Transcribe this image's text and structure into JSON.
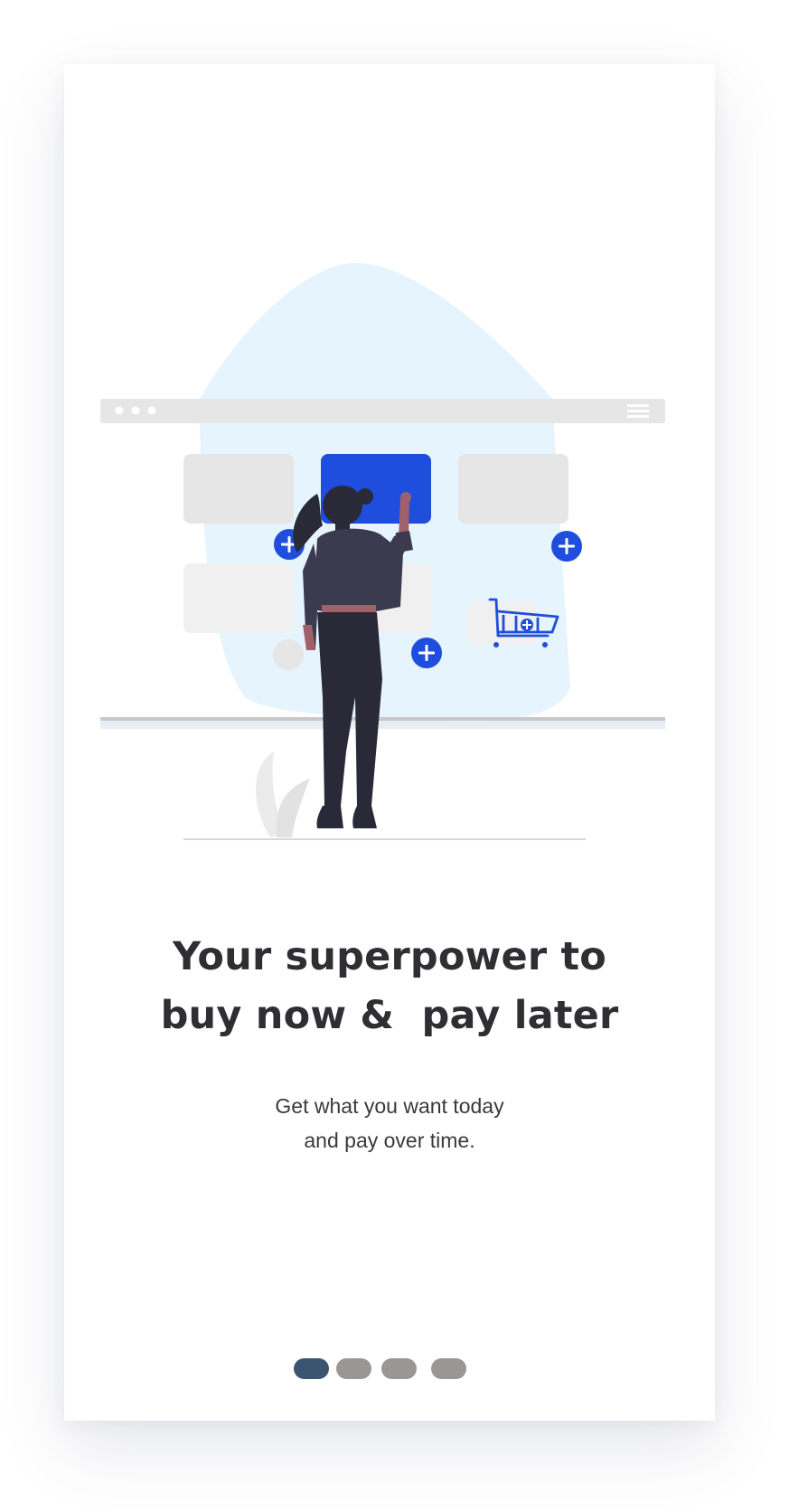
{
  "onboarding": {
    "title_line1": "Your superpower to",
    "title_line2": "buy now &  pay later",
    "subtitle_line1": "Get what you want today",
    "subtitle_line2": "and pay over time."
  },
  "pager": {
    "total": 4,
    "active_index": 0
  },
  "illustration": {
    "icons": [
      "plus-icon",
      "plus-icon",
      "plus-icon",
      "shopping-cart-icon",
      "hamburger-menu-icon"
    ]
  },
  "colors": {
    "accent_blue": "#1f4ede",
    "blob": "#e6f4fd",
    "card_gray": "#e6e6e6",
    "text_dark": "#2f2f33",
    "pager_active": "#3d5470",
    "pager_inactive": "#9a9696"
  }
}
